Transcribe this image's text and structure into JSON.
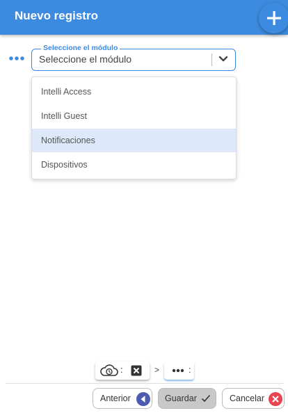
{
  "header": {
    "title": "Nuevo registro",
    "add_icon": "plus-icon"
  },
  "module_select": {
    "label": "Seleccione el módulo",
    "value": "Seleccione el módulo",
    "options": [
      {
        "label": "Intelli Access",
        "selected": false
      },
      {
        "label": "Intelli Guest",
        "selected": false
      },
      {
        "label": "Notificaciones",
        "selected": true
      },
      {
        "label": "Dispositivos",
        "selected": false
      }
    ]
  },
  "status_bar": {
    "colon": ":",
    "separator": ">",
    "icons": [
      "cloud-clock-icon",
      "close-square-icon",
      "more-dots-icon"
    ]
  },
  "footer": {
    "prev_label": "Anterior",
    "save_label": "Guardar",
    "cancel_label": "Cancelar"
  },
  "colors": {
    "primary": "#3d8be0",
    "selected_option": "#dde9fb",
    "cancel_red": "#e64552",
    "prev_indigo": "#4d5bb0"
  }
}
